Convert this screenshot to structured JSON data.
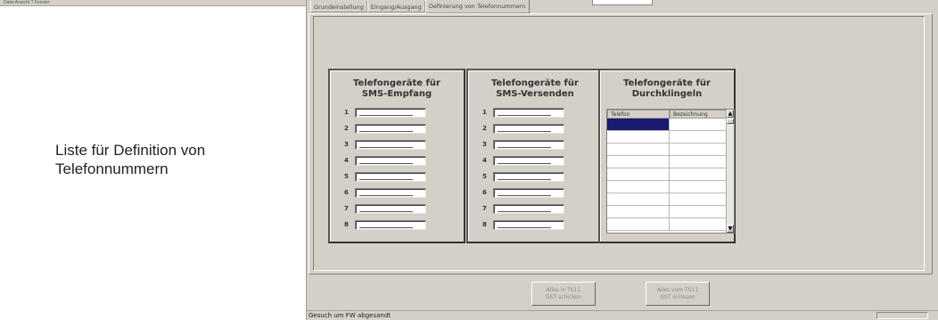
{
  "left": {
    "top_strip_text": "Datei Ansicht ? Fenster",
    "caption_line1": "Liste für Definition von",
    "caption_line2": "Telefonnummern"
  },
  "tabs": [
    {
      "label": "Grundeinstellung"
    },
    {
      "label": "Eingang/Ausgang"
    },
    {
      "label": "Definierung von Telefonnummern"
    }
  ],
  "groups": {
    "sms_empfang": {
      "title_line1": "Telefongeräte für",
      "title_line2": "SMS-Empfang",
      "rows": [
        {
          "num": "1",
          "value": ""
        },
        {
          "num": "2",
          "value": ""
        },
        {
          "num": "3",
          "value": ""
        },
        {
          "num": "4",
          "value": ""
        },
        {
          "num": "5",
          "value": ""
        },
        {
          "num": "6",
          "value": ""
        },
        {
          "num": "7",
          "value": ""
        },
        {
          "num": "8",
          "value": ""
        }
      ]
    },
    "sms_versenden": {
      "title_line1": "Telefongeräte für",
      "title_line2": "SMS-Versenden",
      "rows": [
        {
          "num": "1",
          "value": ""
        },
        {
          "num": "2",
          "value": ""
        },
        {
          "num": "3",
          "value": ""
        },
        {
          "num": "4",
          "value": ""
        },
        {
          "num": "5",
          "value": ""
        },
        {
          "num": "6",
          "value": ""
        },
        {
          "num": "7",
          "value": ""
        },
        {
          "num": "8",
          "value": ""
        }
      ]
    },
    "durchklingeln": {
      "title_line1": "Telefongeräte für",
      "title_line2": "Durchklingeln",
      "columns": [
        "Telefon",
        "Bezeichnung"
      ],
      "row_count": 9
    }
  },
  "buttons": {
    "send_line1": "Alles in TS11",
    "send_line2": "GST schicken",
    "read_line1": "Alles vom TS11",
    "read_line2": "GST einlesen"
  },
  "statusbar": {
    "text": "Gesuch um  FW abgesandt"
  },
  "colors": {
    "window_bg": "#d4d0c8",
    "selection": "#1a1a6e"
  },
  "icons": {
    "scroll_up": "scroll-up-arrow-icon",
    "scroll_down": "scroll-down-arrow-icon"
  }
}
